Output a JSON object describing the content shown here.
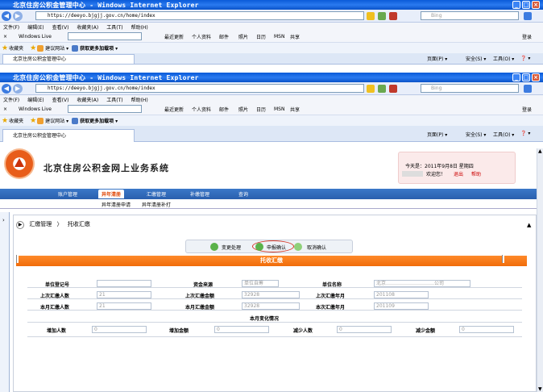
{
  "browser": {
    "title": "北京住房公积金管理中心 - Windows Internet Explorer",
    "url": "https://deeyo.bjgjj.gov.cn/home/index",
    "search_placeholder": "Bing",
    "menu": [
      "文件(F)",
      "编辑(E)",
      "查看(V)",
      "收藏夹(A)",
      "工具(T)",
      "帮助(H)"
    ],
    "windows_live": "Windows Live",
    "live_links": [
      "最近更新",
      "个人资料",
      "邮件",
      "照片",
      "日历",
      "MSN",
      "共享"
    ],
    "login": "登录",
    "favorites_label": "收藏夹",
    "suggested_sites": "建议网站 ▾",
    "addons": "获取更多加载项 ▾",
    "tab_title": "北京住房公积金管理中心",
    "cmd": {
      "page": "页面(P) ▾",
      "safety": "安全(S) ▾",
      "tools": "工具(O) ▾",
      "help": "❓ ▾"
    }
  },
  "app": {
    "system_title": "北京住房公积金网上业务系统",
    "today": "今天是：2011年9月8日 星期四",
    "welcome": "欢迎您！",
    "logout": "退出",
    "help": "帮助",
    "nav": [
      "账户管理",
      "异年清册",
      "汇缴管理",
      "补缴管理",
      "查询"
    ],
    "subnav": [
      "异年清册申请",
      "异年清册补打"
    ],
    "breadcrumb": [
      "汇缴管理",
      "托收汇缴"
    ],
    "buttons": {
      "change": "变更处理",
      "confirm": "申报确认",
      "cancel": "取消确认"
    },
    "section_title": "托收汇缴",
    "form": {
      "reg_no_label": "单位登记号",
      "fund_source_label": "资金来源",
      "fund_source_value": "单位自筹",
      "unit_name_label": "单位名称",
      "unit_name_value": "北京…………………………公司",
      "last_count_label": "上次汇缴人数",
      "last_count_value": "21",
      "last_amount_label": "上次汇缴金额",
      "last_amount_value": "32928",
      "last_month_label": "上次汇缴年月",
      "last_month_value": "201108",
      "this_count_label": "本月汇缴人数",
      "this_count_value": "21",
      "this_amount_label": "本月汇缴金额",
      "this_amount_value": "32928",
      "this_month_label": "本次汇缴年月",
      "this_month_value": "201109",
      "change_title": "本月变化情况",
      "add_people_label": "增加人数",
      "add_people_value": "0",
      "add_amount_label": "增加金额",
      "add_amount_value": "0",
      "reduce_people_label": "减少人数",
      "reduce_people_value": "0",
      "reduce_amount_label": "减少金额",
      "reduce_amount_value": "0"
    }
  }
}
